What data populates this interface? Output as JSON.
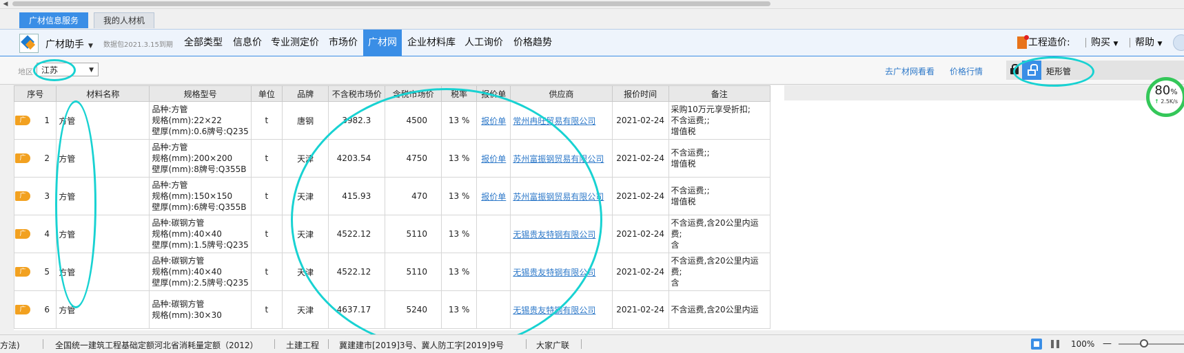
{
  "app_tabs": {
    "active": "广材信息服务",
    "inactive": "我的人材机"
  },
  "nav": {
    "assistant": "广材助手",
    "data_package": "数据包2021.3.15到期",
    "items": [
      "全部类型",
      "信息价",
      "专业测定价",
      "市场价",
      "广材网",
      "企业材料库",
      "人工询价",
      "价格趋势"
    ],
    "active_item": "广材网",
    "right": {
      "cost_label": "工程造价:",
      "buy_label": "购买",
      "help_label": "帮助"
    }
  },
  "filter": {
    "region_label": "地区",
    "region_value": "江苏",
    "go_site_link": "去广材网看看",
    "price_trend_link": "价格行情",
    "search_value": "矩形管"
  },
  "table": {
    "headers": [
      "序号",
      "材料名称",
      "规格型号",
      "单位",
      "品牌",
      "不含税市场价",
      "含税市场价",
      "税率",
      "报价单",
      "供应商",
      "报价时间",
      "备注"
    ],
    "tag_label": "广",
    "rows": [
      {
        "seq": "1",
        "name": "方管",
        "spec": [
          "品种:方管",
          "规格(mm):22×22",
          "壁厚(mm):0.6牌号:Q235"
        ],
        "unit": "t",
        "brand": "唐钢",
        "price_ex_tax": "3982.3",
        "price_inc_tax": "4500",
        "tax_rate": "13 %",
        "quote": "报价单",
        "supplier": "常州冉旺贸易有限公司",
        "date": "2021-02-24",
        "note": [
          "采购10万元享受折扣;",
          "不含运费;;",
          "增值税"
        ]
      },
      {
        "seq": "2",
        "name": "方管",
        "spec": [
          "品种:方管",
          "规格(mm):200×200",
          "壁厚(mm):8牌号:Q355B"
        ],
        "unit": "t",
        "brand": "天津",
        "price_ex_tax": "4203.54",
        "price_inc_tax": "4750",
        "tax_rate": "13 %",
        "quote": "报价单",
        "supplier": "苏州富振钢贸易有限公司",
        "date": "2021-02-24",
        "note": [
          "不含运费;;",
          "增值税"
        ]
      },
      {
        "seq": "3",
        "name": "方管",
        "spec": [
          "品种:方管",
          "规格(mm):150×150",
          "壁厚(mm):6牌号:Q355B"
        ],
        "unit": "t",
        "brand": "天津",
        "price_ex_tax": "415.93",
        "price_inc_tax": "470",
        "tax_rate": "13 %",
        "quote": "报价单",
        "supplier": "苏州富振钢贸易有限公司",
        "date": "2021-02-24",
        "note": [
          "不含运费;;",
          "增值税"
        ]
      },
      {
        "seq": "4",
        "name": "方管",
        "spec": [
          "品种:碳钢方管",
          "规格(mm):40×40",
          "壁厚(mm):1.5牌号:Q235"
        ],
        "unit": "t",
        "brand": "天津",
        "price_ex_tax": "4522.12",
        "price_inc_tax": "5110",
        "tax_rate": "13 %",
        "quote": "",
        "supplier": "无锡贵友特钢有限公司",
        "date": "2021-02-24",
        "note": [
          "不含运费,含20公里内运",
          "费;",
          "含"
        ]
      },
      {
        "seq": "5",
        "name": "方管",
        "spec": [
          "品种:碳钢方管",
          "规格(mm):40×40",
          "壁厚(mm):2.5牌号:Q235"
        ],
        "unit": "t",
        "brand": "天津",
        "price_ex_tax": "4522.12",
        "price_inc_tax": "5110",
        "tax_rate": "13 %",
        "quote": "",
        "supplier": "无锡贵友特钢有限公司",
        "date": "2021-02-24",
        "note": [
          "不含运费,含20公里内运",
          "费;",
          "含"
        ]
      },
      {
        "seq": "6",
        "name": "方管",
        "spec": [
          "品种:碳钢方管",
          "规格(mm):30×30",
          ""
        ],
        "unit": "t",
        "brand": "天津",
        "price_ex_tax": "4637.17",
        "price_inc_tax": "5240",
        "tax_rate": "13 %",
        "quote": "",
        "supplier": "无锡贵友特钢有限公司",
        "date": "2021-02-24",
        "note": [
          "不含运费,含20公里内运",
          "",
          ""
        ]
      }
    ]
  },
  "speed_widget": {
    "percent": "80",
    "percent_unit": "%",
    "rate": "2.5K/s"
  },
  "status": {
    "method": "方法)",
    "quota": "全国统一建筑工程基础定额河北省消耗量定额（2012）",
    "discipline": "土建工程",
    "doc": "冀建建市[2019]3号、冀人防工字[2019]9号",
    "party": "大家广联",
    "zoom": "100%"
  },
  "colors": {
    "accent": "#3a8ee6",
    "annotation": "#18d2d2",
    "link": "#2e79c9",
    "tag": "#f2a120"
  }
}
